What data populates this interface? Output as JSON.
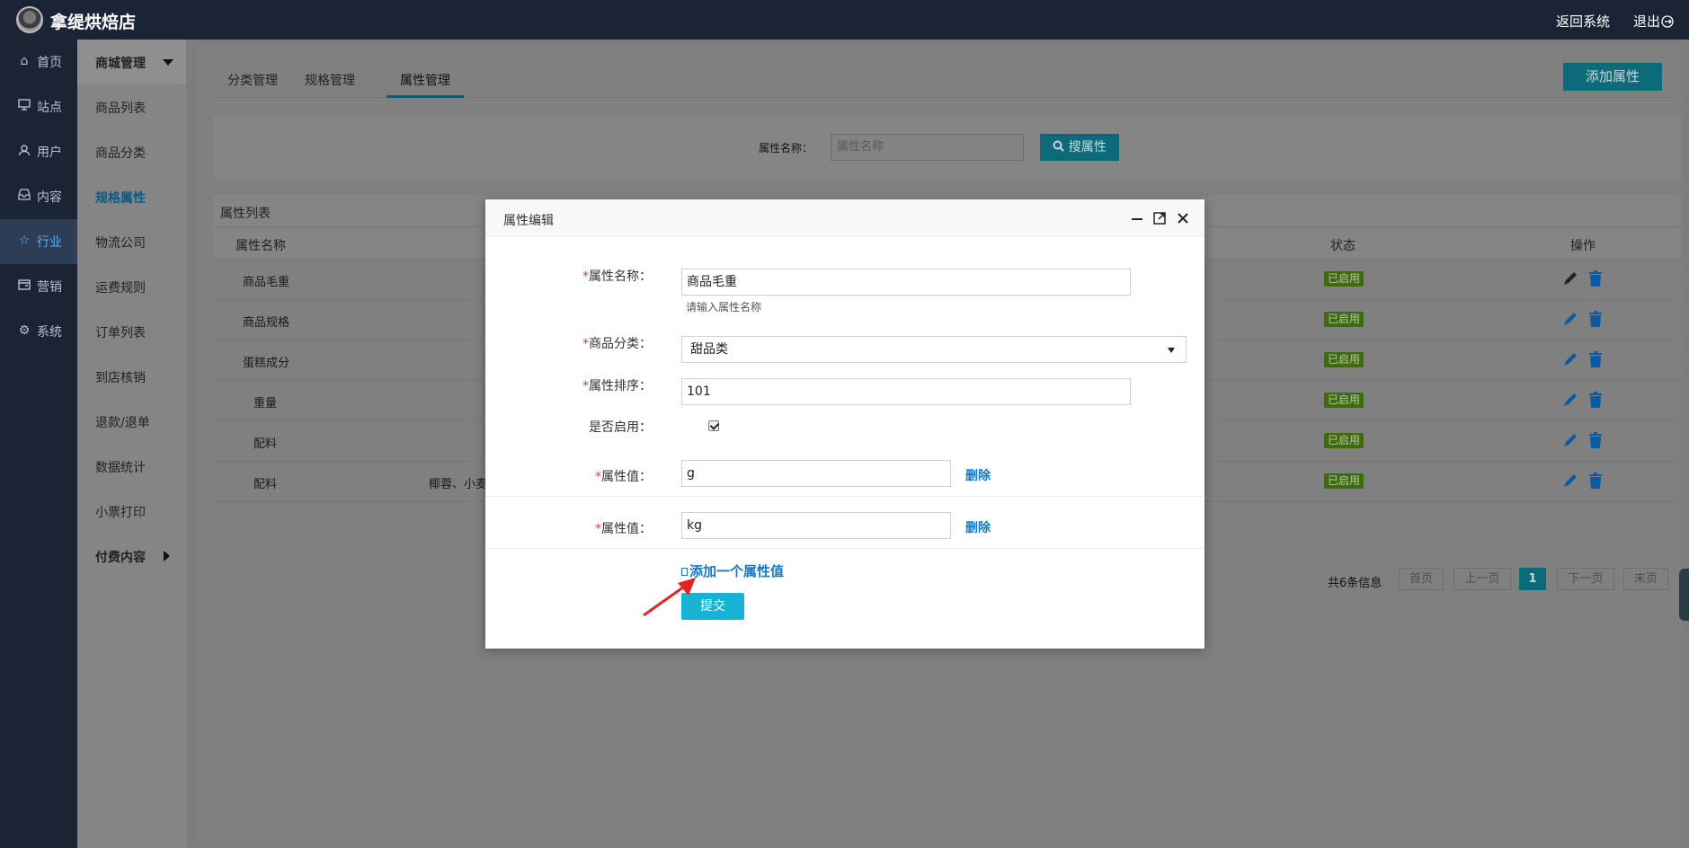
{
  "header": {
    "shop_name": "拿缇烘焙店",
    "back_label": "返回系统",
    "logout_label": "退出"
  },
  "nav_primary": [
    {
      "label": "首页",
      "icon": "home-icon",
      "active": false
    },
    {
      "label": "站点",
      "icon": "monitor-icon",
      "active": false
    },
    {
      "label": "用户",
      "icon": "user-icon",
      "active": false
    },
    {
      "label": "内容",
      "icon": "inbox-icon",
      "active": false
    },
    {
      "label": "行业",
      "icon": "star-icon",
      "active": true
    },
    {
      "label": "营销",
      "icon": "wallet-icon",
      "active": false
    },
    {
      "label": "系统",
      "icon": "gear-icon",
      "active": false
    }
  ],
  "nav_secondary": {
    "group_title": "商城管理",
    "items": [
      "商品列表",
      "商品分类",
      "规格属性",
      "物流公司",
      "运费规则",
      "订单列表",
      "到店核销",
      "退款/退单",
      "数据统计",
      "小票打印"
    ],
    "current": "规格属性",
    "paid_group": "付费内容"
  },
  "tabs": [
    "分类管理",
    "规格管理",
    "属性管理"
  ],
  "active_tab": "属性管理",
  "add_button": "添加属性",
  "search": {
    "label": "属性名称：",
    "placeholder": "属性名称",
    "button": "搜属性"
  },
  "list": {
    "title": "属性列表",
    "columns": {
      "name": "属性名称",
      "status": "状态",
      "ops": "操作"
    },
    "rows": [
      {
        "name": "商品毛重",
        "values": "",
        "status": "已启用"
      },
      {
        "name": "商品规格",
        "values": "",
        "status": "已启用"
      },
      {
        "name": "蛋糕成分",
        "values": "",
        "status": "已启用"
      },
      {
        "name": "重量",
        "values": "",
        "status": "已启用"
      },
      {
        "name": "配料",
        "values": "",
        "status": "已启用"
      },
      {
        "name": "配料",
        "values": "椰蓉、小麦",
        "status": "已启用"
      }
    ]
  },
  "pagination": {
    "info": "共6条信息",
    "first": "首页",
    "prev": "上一页",
    "current": "1",
    "next": "下一页",
    "last": "末页"
  },
  "modal": {
    "title": "属性编辑",
    "fields": {
      "name_label": "属性名称：",
      "name_value": "商品毛重",
      "name_hint": "请输入属性名称",
      "category_label": "商品分类：",
      "category_value": "甜品类",
      "sort_label": "属性排序：",
      "sort_value": "101",
      "enabled_label": "是否启用：",
      "value_label": "属性值：",
      "values": [
        "g",
        "kg"
      ],
      "delete_label": "删除",
      "add_value_label": "添加一个属性值",
      "submit_label": "提交"
    }
  },
  "colors": {
    "topbar": "#1b2434",
    "accent": "#16b4d4",
    "link": "#1478c8",
    "required": "#e4393c",
    "status_green": "#6aa61f"
  }
}
